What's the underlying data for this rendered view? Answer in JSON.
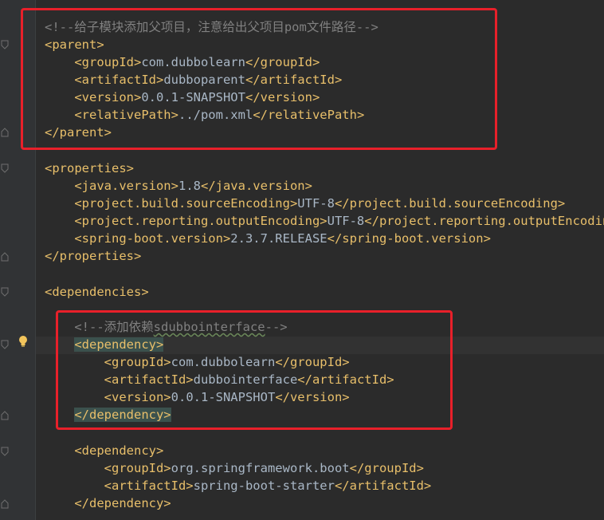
{
  "colors": {
    "background": "#2b2b2b",
    "tag": "#e8bf6a",
    "text": "#a9b7c6",
    "comment": "#808080",
    "highlight_box": "#e8202a",
    "matched_tag_bg": "#3b514d"
  },
  "code": {
    "comment_parent": "<!--给子模块添加父项目，注意给出父项目pom文件路径-->",
    "parent_open": "<parent>",
    "parent_groupId_open": "<groupId>",
    "parent_groupId_value": "com.dubbolearn",
    "parent_groupId_close": "</groupId>",
    "parent_artifactId_open": "<artifactId>",
    "parent_artifactId_value": "dubboparent",
    "parent_artifactId_close": "</artifactId>",
    "parent_version_open": "<version>",
    "parent_version_value": "0.0.1-SNAPSHOT",
    "parent_version_close": "</version>",
    "parent_relativePath_open": "<relativePath>",
    "parent_relativePath_value": "../pom.xml",
    "parent_relativePath_close": "</relativePath>",
    "parent_close": "</parent>",
    "properties_open": "<properties>",
    "java_version_open": "<java.version>",
    "java_version_value": "1.8",
    "java_version_close": "</java.version>",
    "source_encoding_open": "<project.build.sourceEncoding>",
    "source_encoding_value": "UTF-8",
    "source_encoding_close": "</project.build.sourceEncoding>",
    "output_encoding_open": "<project.reporting.outputEncoding>",
    "output_encoding_value": "UTF-8",
    "output_encoding_close": "</project.reporting.outputEncoding>",
    "spring_boot_version_open": "<spring-boot.version>",
    "spring_boot_version_value": "2.3.7.RELEASE",
    "spring_boot_version_close": "</spring-boot.version>",
    "properties_close": "</properties>",
    "dependencies_open": "<dependencies>",
    "comment_dependency_prefix": "<!--添加依赖",
    "comment_dependency_word": "sdubbointerface",
    "comment_dependency_suffix": "-->",
    "dep1_open": "<dependency>",
    "dep1_groupId_open": "<groupId>",
    "dep1_groupId_value": "com.dubbolearn",
    "dep1_groupId_close": "</groupId>",
    "dep1_artifactId_open": "<artifactId>",
    "dep1_artifactId_value": "dubbointerface",
    "dep1_artifactId_close": "</artifactId>",
    "dep1_version_open": "<version>",
    "dep1_version_value": "0.0.1-SNAPSHOT",
    "dep1_version_close": "</version>",
    "dep1_close": "</dependency>",
    "dep2_open": "<dependency>",
    "dep2_groupId_open": "<groupId>",
    "dep2_groupId_value": "org.springframework.boot",
    "dep2_groupId_close": "</groupId>",
    "dep2_artifactId_open": "<artifactId>",
    "dep2_artifactId_value": "spring-boot-starter",
    "dep2_artifactId_close": "</artifactId>",
    "dep2_close": "</dependency>"
  },
  "icons": {
    "fold": "fold-marker-icon",
    "intention": "lightbulb-icon"
  }
}
